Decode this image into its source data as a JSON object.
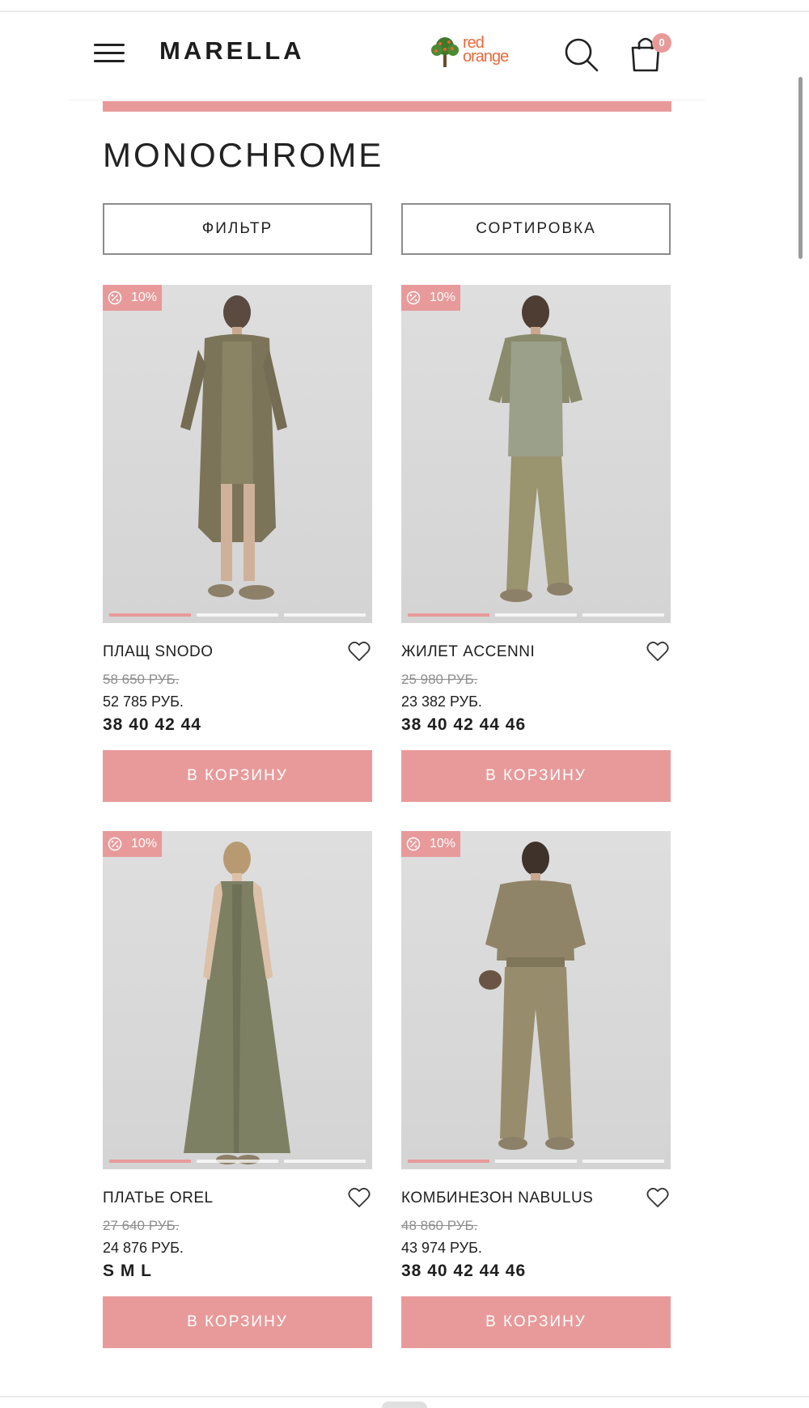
{
  "header": {
    "brand": "MARELLA",
    "partner_logo_line1": "red",
    "partner_logo_line2": "orange",
    "cart_count": "0"
  },
  "page": {
    "title": "MONOCHROME",
    "filter_label": "ФИЛЬТР",
    "sort_label": "СОРТИРОВКА"
  },
  "colors": {
    "accent": "#e89a9a",
    "text": "#1e1e1e",
    "muted": "#8e8e8e"
  },
  "products": [
    {
      "name": "ПЛАЩ SNODO",
      "discount": "10%",
      "old_price": "58 650 РУБ.",
      "price": "52 785 РУБ.",
      "sizes": "38 40 42 44",
      "button": "В КОРЗИНУ",
      "active_slide": 1,
      "photo_icon": "model-photo"
    },
    {
      "name": "ЖИЛЕТ ACCENNI",
      "discount": "10%",
      "old_price": "25 980 РУБ.",
      "price": "23 382 РУБ.",
      "sizes": "38 40 42 44 46",
      "button": "В КОРЗИНУ",
      "active_slide": 1,
      "photo_icon": "model-photo"
    },
    {
      "name": "ПЛАТЬЕ OREL",
      "discount": "10%",
      "old_price": "27 640 РУБ.",
      "price": "24 876 РУБ.",
      "sizes": "S M L",
      "button": "В КОРЗИНУ",
      "active_slide": 1,
      "photo_icon": "model-photo"
    },
    {
      "name": "КОМБИНЕЗОН NABULUS",
      "discount": "10%",
      "old_price": "48 860 РУБ.",
      "price": "43 974 РУБ.",
      "sizes": "38 40 42 44 46",
      "button": "В КОРЗИНУ",
      "active_slide": 1,
      "photo_icon": "model-photo"
    }
  ]
}
